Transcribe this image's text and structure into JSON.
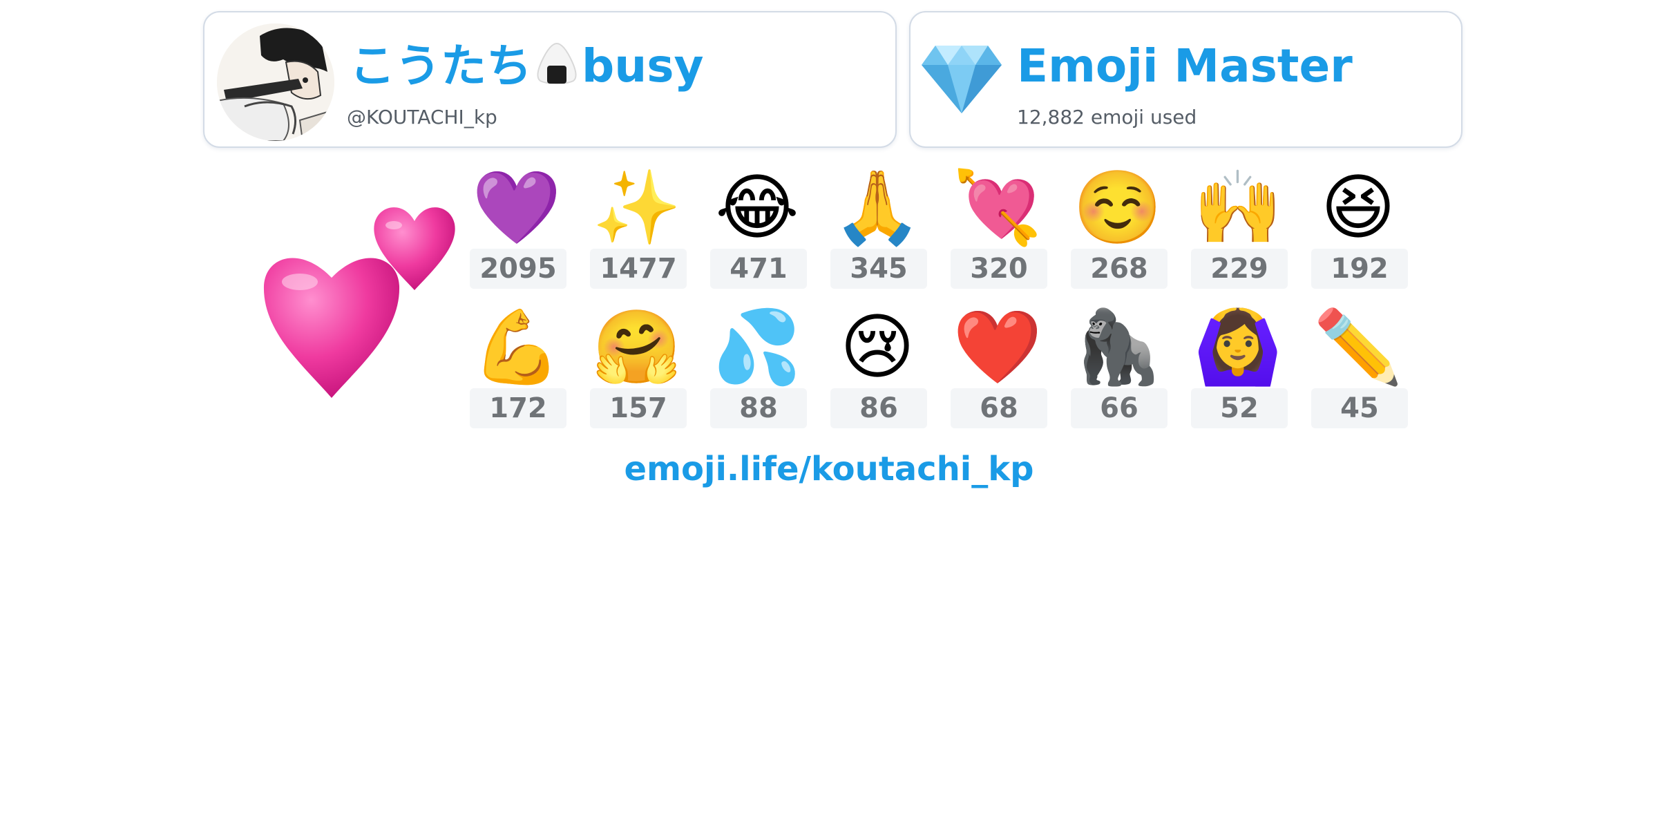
{
  "profile": {
    "display_name": "こうたち",
    "status_emoji_icon": "onigiri-icon",
    "status_text": "busy",
    "handle": "@KOUTACHI_kp",
    "avatar_icon": "user-avatar"
  },
  "stats": {
    "badge_icon": "gem-icon",
    "title": "Emoji Master",
    "subtitle": "12,882 emoji used"
  },
  "featured_emoji": {
    "emoji": "💕",
    "icon": "two-hearts-icon"
  },
  "emoji_counts": [
    {
      "emoji": "💜",
      "name": "purple-heart",
      "count": "2095"
    },
    {
      "emoji": "✨",
      "name": "sparkles",
      "count": "1477"
    },
    {
      "emoji": "😂",
      "name": "tears-of-joy",
      "count": "471"
    },
    {
      "emoji": "🙏",
      "name": "folded-hands",
      "count": "345"
    },
    {
      "emoji": "💘",
      "name": "heart-with-arrow",
      "count": "320"
    },
    {
      "emoji": "☺️",
      "name": "smiling-face",
      "count": "268"
    },
    {
      "emoji": "🙌",
      "name": "raising-hands",
      "count": "229"
    },
    {
      "emoji": "😆",
      "name": "grinning-squinting",
      "count": "192"
    },
    {
      "emoji": "💪",
      "name": "flexed-biceps",
      "count": "172"
    },
    {
      "emoji": "🤗",
      "name": "hugging-face",
      "count": "157"
    },
    {
      "emoji": "💦",
      "name": "sweat-droplets",
      "count": "88"
    },
    {
      "emoji": "😢",
      "name": "crying-face",
      "count": "86"
    },
    {
      "emoji": "❤️",
      "name": "red-heart",
      "count": "68"
    },
    {
      "emoji": "🦍",
      "name": "gorilla",
      "count": "66"
    },
    {
      "emoji": "🙆‍♀️",
      "name": "woman-gesturing-ok",
      "count": "52"
    },
    {
      "emoji": "✏️",
      "name": "pencil",
      "count": "45"
    }
  ],
  "colors": {
    "accent": "#1a9be6",
    "count_bg": "#f3f5f7",
    "count_text": "#6f7377"
  },
  "link": "emoji.life/koutachi_kp"
}
